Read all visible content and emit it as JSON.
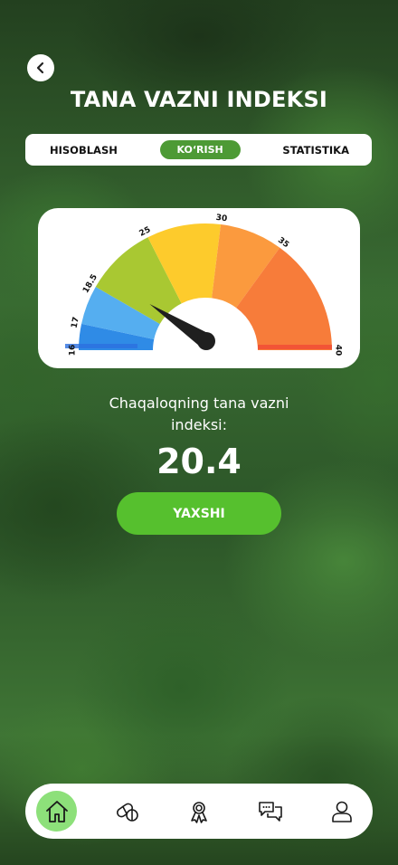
{
  "page_title": "TANA VAZNI INDEKSI",
  "back_button": {
    "icon": "chevron-left-icon"
  },
  "tabs": [
    {
      "label": "HISOBLASH",
      "active": false
    },
    {
      "label": "KO‘RISH",
      "active": true
    },
    {
      "label": "STATISTIKA",
      "active": false
    }
  ],
  "gauge": {
    "scale_labels": [
      "16",
      "17",
      "18.5",
      "25",
      "30",
      "35",
      "40"
    ],
    "segments": [
      {
        "from": 16,
        "to": 17,
        "color": "#2f8be6"
      },
      {
        "from": 17,
        "to": 18.5,
        "color": "#55aef0"
      },
      {
        "from": 18.5,
        "to": 25,
        "color": "#a9c832"
      },
      {
        "from": 25,
        "to": 30,
        "color": "#fdcb2c"
      },
      {
        "from": 30,
        "to": 35,
        "color": "#fb9a3e"
      },
      {
        "from": 35,
        "to": 40,
        "color": "#f77c3a"
      }
    ],
    "value": 20.4
  },
  "caption": "Chaqaloqning tana vazni indeksi:",
  "bmi_value": "20.4",
  "status_label": "YAXSHI",
  "status_color": "#56c02e",
  "bottom_nav": [
    {
      "name": "home",
      "icon": "home-icon",
      "active": true
    },
    {
      "name": "pills",
      "icon": "pills-icon",
      "active": false
    },
    {
      "name": "award",
      "icon": "award-ribbon-icon",
      "active": false
    },
    {
      "name": "chat",
      "icon": "chat-bubbles-icon",
      "active": false
    },
    {
      "name": "profile",
      "icon": "user-icon",
      "active": false
    }
  ]
}
